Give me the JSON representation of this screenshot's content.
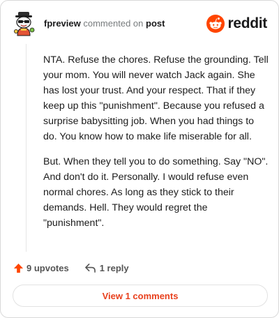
{
  "header": {
    "username": "fpreview",
    "action_text": "commented on",
    "post_link": "post",
    "brand": "reddit"
  },
  "comment": {
    "paragraphs": [
      "NTA. Refuse the chores. Refuse the grounding. Tell your mom. You will never watch Jack again. She has lost your trust. And your respect. That if they keep up this \"punishment\". Because you refused a surprise babysitting job. When you had things to do. You know how to make life miserable for all.",
      "But. When they tell you to do something. Say \"NO\". And don't do it. Personally. I would refuse even normal chores. As long as they stick to their demands. Hell. They would regret the \"punishment\"."
    ]
  },
  "actions": {
    "upvotes": "9 upvotes",
    "replies": "1 reply"
  },
  "view_comments": "View 1 comments",
  "colors": {
    "reddit_orange": "#ff4500",
    "link_orange": "#e8401d",
    "border": "#d9d9d9"
  },
  "icons": [
    "snoo-avatar-icon",
    "reddit-logo-icon",
    "upvote-arrow-icon",
    "reply-arrow-icon"
  ]
}
